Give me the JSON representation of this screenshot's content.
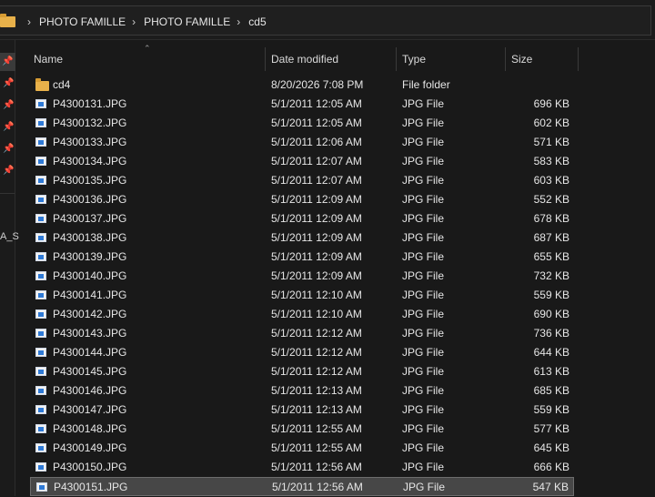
{
  "breadcrumb": [
    "PHOTO FAMILLE",
    "PHOTO FAMILLE",
    "cd5"
  ],
  "nav": {
    "partial_label": "A_S"
  },
  "columns": {
    "name": "Name",
    "date": "Date modified",
    "type": "Type",
    "size": "Size"
  },
  "files": [
    {
      "name": "cd4",
      "date": "8/20/2026 7:08 PM",
      "type": "File folder",
      "size": "",
      "kind": "folder"
    },
    {
      "name": "P4300131.JPG",
      "date": "5/1/2011 12:05 AM",
      "type": "JPG File",
      "size": "696 KB",
      "kind": "image"
    },
    {
      "name": "P4300132.JPG",
      "date": "5/1/2011 12:05 AM",
      "type": "JPG File",
      "size": "602 KB",
      "kind": "image"
    },
    {
      "name": "P4300133.JPG",
      "date": "5/1/2011 12:06 AM",
      "type": "JPG File",
      "size": "571 KB",
      "kind": "image"
    },
    {
      "name": "P4300134.JPG",
      "date": "5/1/2011 12:07 AM",
      "type": "JPG File",
      "size": "583 KB",
      "kind": "image"
    },
    {
      "name": "P4300135.JPG",
      "date": "5/1/2011 12:07 AM",
      "type": "JPG File",
      "size": "603 KB",
      "kind": "image"
    },
    {
      "name": "P4300136.JPG",
      "date": "5/1/2011 12:09 AM",
      "type": "JPG File",
      "size": "552 KB",
      "kind": "image"
    },
    {
      "name": "P4300137.JPG",
      "date": "5/1/2011 12:09 AM",
      "type": "JPG File",
      "size": "678 KB",
      "kind": "image"
    },
    {
      "name": "P4300138.JPG",
      "date": "5/1/2011 12:09 AM",
      "type": "JPG File",
      "size": "687 KB",
      "kind": "image"
    },
    {
      "name": "P4300139.JPG",
      "date": "5/1/2011 12:09 AM",
      "type": "JPG File",
      "size": "655 KB",
      "kind": "image"
    },
    {
      "name": "P4300140.JPG",
      "date": "5/1/2011 12:09 AM",
      "type": "JPG File",
      "size": "732 KB",
      "kind": "image"
    },
    {
      "name": "P4300141.JPG",
      "date": "5/1/2011 12:10 AM",
      "type": "JPG File",
      "size": "559 KB",
      "kind": "image"
    },
    {
      "name": "P4300142.JPG",
      "date": "5/1/2011 12:10 AM",
      "type": "JPG File",
      "size": "690 KB",
      "kind": "image"
    },
    {
      "name": "P4300143.JPG",
      "date": "5/1/2011 12:12 AM",
      "type": "JPG File",
      "size": "736 KB",
      "kind": "image"
    },
    {
      "name": "P4300144.JPG",
      "date": "5/1/2011 12:12 AM",
      "type": "JPG File",
      "size": "644 KB",
      "kind": "image"
    },
    {
      "name": "P4300145.JPG",
      "date": "5/1/2011 12:12 AM",
      "type": "JPG File",
      "size": "613 KB",
      "kind": "image"
    },
    {
      "name": "P4300146.JPG",
      "date": "5/1/2011 12:13 AM",
      "type": "JPG File",
      "size": "685 KB",
      "kind": "image"
    },
    {
      "name": "P4300147.JPG",
      "date": "5/1/2011 12:13 AM",
      "type": "JPG File",
      "size": "559 KB",
      "kind": "image"
    },
    {
      "name": "P4300148.JPG",
      "date": "5/1/2011 12:55 AM",
      "type": "JPG File",
      "size": "577 KB",
      "kind": "image"
    },
    {
      "name": "P4300149.JPG",
      "date": "5/1/2011 12:55 AM",
      "type": "JPG File",
      "size": "645 KB",
      "kind": "image"
    },
    {
      "name": "P4300150.JPG",
      "date": "5/1/2011 12:56 AM",
      "type": "JPG File",
      "size": "666 KB",
      "kind": "image"
    },
    {
      "name": "P4300151.JPG",
      "date": "5/1/2011 12:56 AM",
      "type": "JPG File",
      "size": "547 KB",
      "kind": "image",
      "selected": true
    }
  ]
}
